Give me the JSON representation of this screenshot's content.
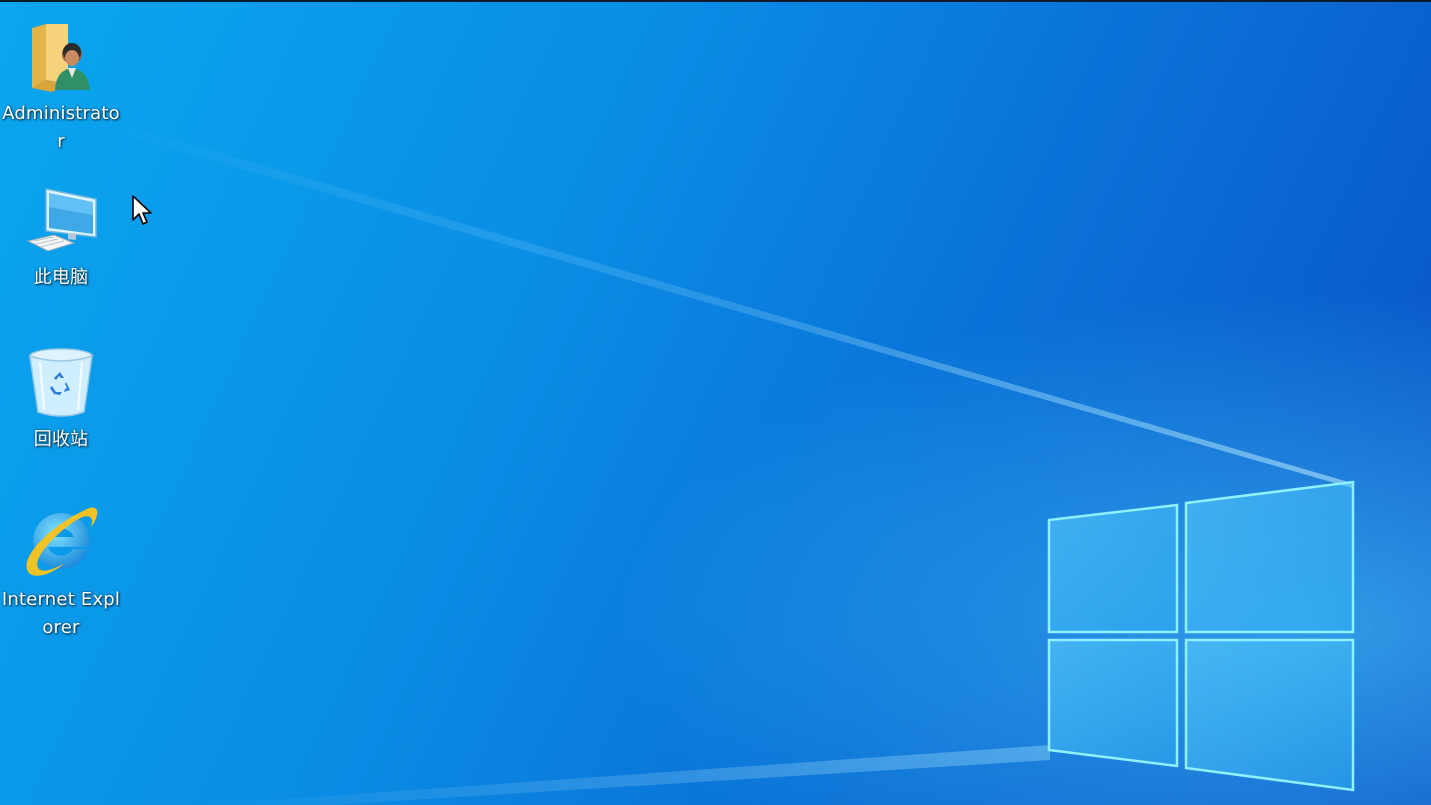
{
  "desktop": {
    "icons": [
      {
        "label": "Administrator",
        "icon": "user-folder-icon"
      },
      {
        "label": "此电脑",
        "icon": "computer-icon"
      },
      {
        "label": "回收站",
        "icon": "recycle-bin-icon"
      },
      {
        "label": "Internet Explorer",
        "icon": "internet-explorer-icon"
      }
    ]
  },
  "colors": {
    "wallpaper_light": "#0aa6ee",
    "wallpaper_dark": "#0a4fc4",
    "logo_glow": "#7fe3ff"
  }
}
